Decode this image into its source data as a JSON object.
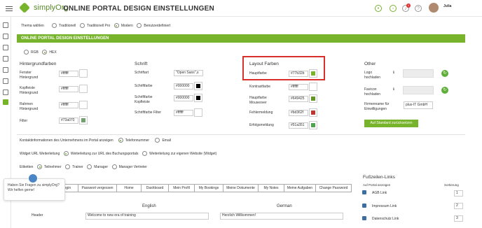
{
  "header": {
    "title": "ONLINE PORTAL DESIGN EINSTELLUNGEN",
    "brand": "simplyOrg",
    "user_name": "Julia",
    "notification_count": "1"
  },
  "theme": {
    "label": "Thema wählen",
    "options": [
      "Traditionell",
      "Traditionell Pro",
      "Modern",
      "Benutzerdefiniert"
    ],
    "selected": "Modern"
  },
  "banner": "ONLINE PORTAL DESIGN EINSTELLUNGEN",
  "color_mode": {
    "options": [
      "RGB",
      "HEX"
    ],
    "selected": "HEX"
  },
  "background": {
    "heading": "Hintergrundfarben",
    "rows": [
      {
        "label": "Fenster Hintergrund",
        "value": "#ffffff",
        "color": "#ffffff"
      },
      {
        "label": "Kopfleiste Hintergrund",
        "value": "#ffffff",
        "color": "#ffffff"
      },
      {
        "label": "Rahmen Hintergrund",
        "value": "#ffffff",
        "color": "#ffffff"
      },
      {
        "label": "Filter",
        "value": "#73a070",
        "color": "#73a070"
      }
    ]
  },
  "font": {
    "heading": "Schrift",
    "rows": [
      {
        "label": "Schriftart",
        "value": "\"Open Sans\",s",
        "color": null
      },
      {
        "label": "Schriftfarbe",
        "value": "#000000",
        "color": "#000000"
      },
      {
        "label": "Schriftfarbe Kopfleiste",
        "value": "#000000",
        "color": "#000000"
      },
      {
        "label": "Schriftfarbe Filter",
        "value": "#ffffff",
        "color": "#ffffff"
      }
    ]
  },
  "layout": {
    "heading": "Layout Farben",
    "rows": [
      {
        "label": "Hauptfarbe",
        "value": "#77b32b",
        "color": "#77b32b"
      },
      {
        "label": "Kontrastfarbe",
        "value": "#ffffff",
        "color": "#ffffff"
      },
      {
        "label": "Hauptfarbe Mouseover",
        "value": "#649425",
        "color": "#649425"
      },
      {
        "label": "Fehlermeldung",
        "value": "#bd362f",
        "color": "#bd362f"
      },
      {
        "label": "Erfolgsmeldung",
        "value": "#51a351",
        "color": "#51a351"
      }
    ]
  },
  "other": {
    "heading": "Other",
    "logo_label": "Logo hochladen",
    "favicon_label": "Favicon hochladen",
    "company_label": "Firmenname für Einwilligungen",
    "company_value": "plus-IT GmbH",
    "reset_button": "Auf Standard zurücksetzen"
  },
  "contact": {
    "label": "Kontaktinformationen des Unternehmens im Portal anzeigen",
    "options": [
      "Telefonnummer",
      "Email"
    ],
    "selected": "Telefonnummer"
  },
  "widget": {
    "label": "Widget URL Weiterleitung",
    "options": [
      "Weiterleitung zur URL des Buchungsportals",
      "Weiterleitung zur eigenen Website (Widget)"
    ],
    "selected": "Weiterleitung zur URL des Buchungsportals"
  },
  "labels": {
    "label": "Etiketten",
    "options": [
      "Teilnehmer",
      "Trainer",
      "Manager",
      "Manager Vertreter"
    ],
    "selected": "Teilnehmer"
  },
  "menu_preview": [
    "Login",
    "Passwort vergessen",
    "Home",
    "Dashboard",
    "Mein Profil",
    "My Bookings",
    "Meine Dokumente",
    "My Notes",
    "Meine Aufgaben",
    "Change Password"
  ],
  "translations": {
    "col_english": "English",
    "col_german": "German",
    "row_label": "Header",
    "english_value": "Welcome to new era of training",
    "german_value": "Herzlich Willkommen!"
  },
  "footer_links": {
    "heading": "Fußzeilen-Links",
    "col_show": "Auf Portal anzeigen",
    "col_sort": "Sortierung",
    "rows": [
      {
        "label": "AGB Link",
        "sort": "1"
      },
      {
        "label": "Impressum Link",
        "sort": "2"
      },
      {
        "label": "Datenschutz Link",
        "sort": "3"
      }
    ]
  },
  "chat": {
    "message": "Haben Sie Fragen zu simplyOrg? Wir helfen gerne!"
  },
  "colors": {
    "accent": "#77b32b",
    "highlight": "#d9302c"
  }
}
